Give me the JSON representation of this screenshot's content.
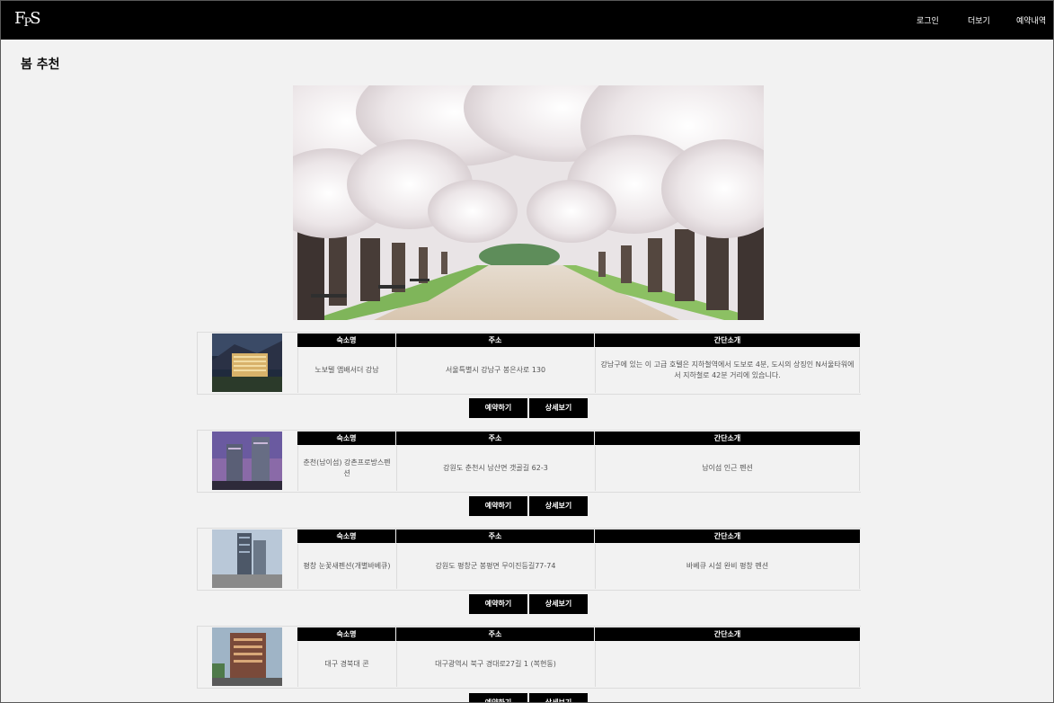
{
  "nav": {
    "logo_big": "F",
    "logo_small": "P",
    "logo_end": "S",
    "login": "로그인",
    "more": "더보기",
    "reservations": "예약내역"
  },
  "page": {
    "title": "봄 추천"
  },
  "table_headers": {
    "name": "숙소명",
    "address": "주소",
    "intro": "간단소개"
  },
  "buttons": {
    "reserve": "예약하기",
    "detail": "상세보기"
  },
  "listings": [
    {
      "name": "노보텔 앰배서더 강남",
      "address": "서울특별시 강남구 봉은사로 130",
      "intro": "강남구에 있는 이 고급 호텔은 지하철역에서 도보로 4분, 도시의 상징인 N서울타워에서 지하철로 42분 거리에 있습니다."
    },
    {
      "name": "춘천(남이섬) 강촌프로방스펜션",
      "address": "강원도 춘천시 남산면 갯골길 62-3",
      "intro": "남이섬 인근 펜션"
    },
    {
      "name": "평창 눈꽃새펜션(개별바베큐)",
      "address": "강원도 평창군 봉평면 무이진등길77-74",
      "intro": "바베큐 시설 완비 평창 펜션"
    },
    {
      "name": "대구 경북대 콘",
      "address": "대구광역시 북구 경대로27길 1 (복현동)",
      "intro": ""
    }
  ],
  "colors": {
    "navbar": "#000000",
    "background": "#f2f2f2",
    "button": "#000000",
    "header_cell": "#000000"
  }
}
